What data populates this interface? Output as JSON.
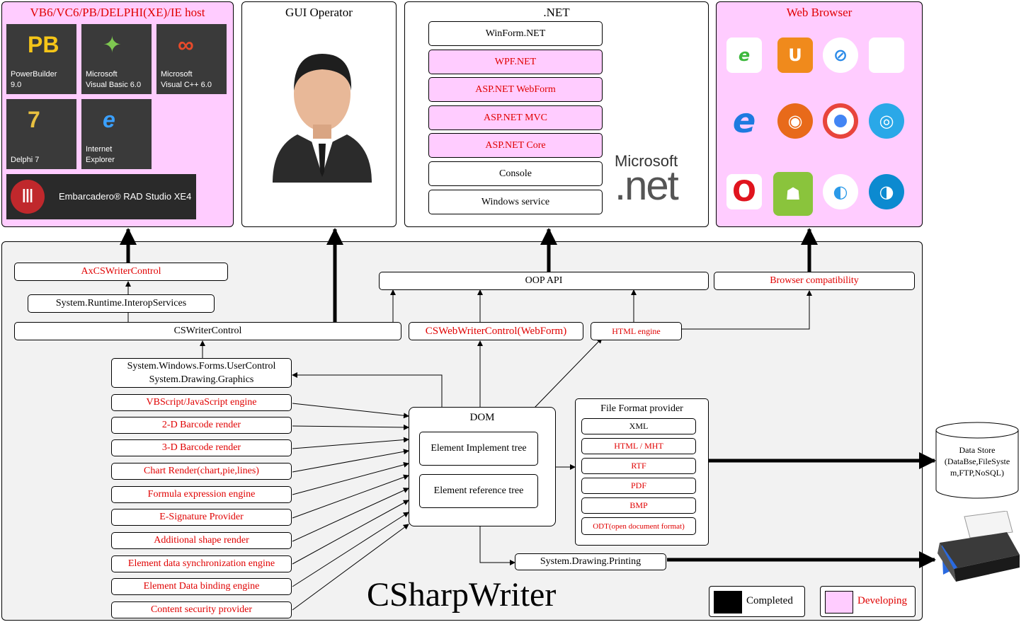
{
  "hosts": {
    "title": "VB6/VC6/PB/DELPHI(XE)/IE host",
    "tiles": [
      {
        "line1": "PowerBuilder",
        "line2": "9.0"
      },
      {
        "line1": "Microsoft",
        "line2": "Visual Basic 6.0"
      },
      {
        "line1": "Microsoft",
        "line2": "Visual C++ 6.0"
      },
      {
        "line1": "Delphi 7",
        "line2": ""
      },
      {
        "line1": "Internet",
        "line2": "Explorer"
      }
    ],
    "embarcadero": "Embarcadero® RAD Studio XE4"
  },
  "gui": {
    "title": "GUI Operator"
  },
  "dotnet": {
    "title": ".NET",
    "items": [
      "WinForm.NET",
      "WPF.NET",
      "ASP.NET WebForm",
      "ASP.NET MVC",
      "ASP.NET Core",
      "Console",
      "Windows service"
    ],
    "logo_top": "Microsoft",
    "logo_bottom": ".net"
  },
  "browser": {
    "title": "Web Browser",
    "icons": [
      "ie-classic-icon",
      "uc-browser-icon",
      "safari-icon",
      "apple-icon",
      "internet-explorer-icon",
      "firefox-icon",
      "chrome-icon",
      "browser-360-icon",
      "opera-icon",
      "android-icon",
      "qq-browser-icon",
      "edge-icon"
    ]
  },
  "main": {
    "axcontrol": "AxCSWriterControl",
    "interop": "System.Runtime.InteropServices",
    "cswriter": "CSWriterControl",
    "webwriter": "CSWebWriterControl(WebForm)",
    "htmlengine": "HTML engine",
    "oopapi": "OOP API",
    "browsercompat": "Browser compatibility",
    "usercontrol_l1": "System.Windows.Forms.UserControl",
    "usercontrol_l2": "System.Drawing.Graphics",
    "engines": [
      "VBScript/JavaScript engine",
      "2-D Barcode render",
      "3-D Barcode render",
      "Chart Render(chart,pie,lines)",
      "Formula expression engine",
      "E-Signature Provider",
      "Additional shape render",
      "Element data synchronization engine",
      "Element Data binding engine",
      "Content security provider"
    ],
    "dom_title": "DOM",
    "dom_impl": "Element Implement tree",
    "dom_ref": "Element reference tree",
    "ffp_title": "File Format provider",
    "formats": [
      "XML",
      "HTML / MHT",
      "RTF",
      "PDF",
      "BMP",
      "ODT(open document format)"
    ],
    "printing": "System.Drawing.Printing",
    "brand": "CSharpWriter"
  },
  "datastore": {
    "line1": "Data Store",
    "line2": "(DataBse,FileSyste",
    "line3": "m,FTP,NoSQL)"
  },
  "legend": {
    "completed": "Completed",
    "developing": "Developing"
  },
  "colors": {
    "developing": "#ffccff",
    "accent_red": "#e00000",
    "completed": "#000000"
  }
}
